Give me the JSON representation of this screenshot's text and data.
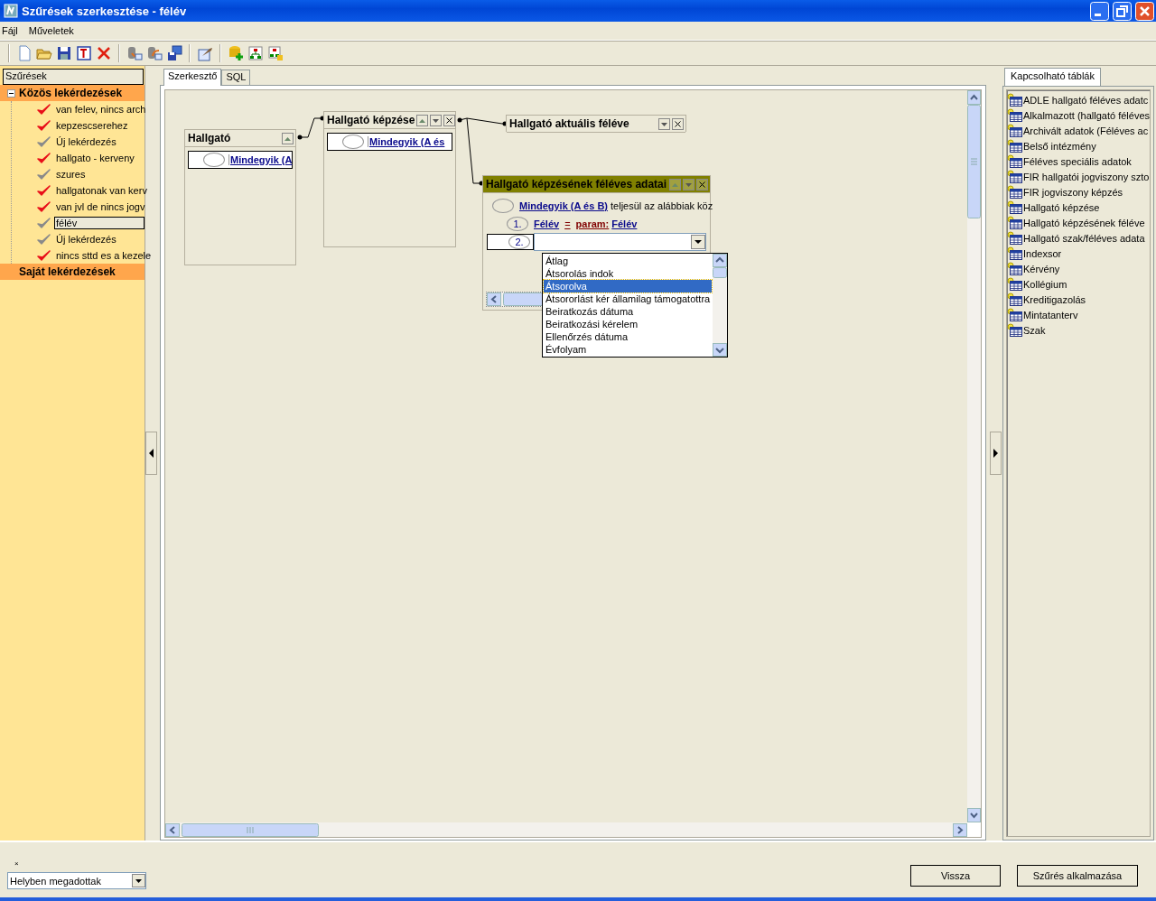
{
  "window": {
    "title": "Szűrések szerkesztése - félév"
  },
  "menu": [
    {
      "label": "Fájl"
    },
    {
      "label": "Műveletek"
    }
  ],
  "tree": {
    "header": "Szűrések",
    "groups": [
      {
        "label": "Közös lekérdezések",
        "expanded": true,
        "children": [
          {
            "label": "van felev, nincs arch",
            "active": true,
            "selected": false
          },
          {
            "label": "kepzescserehez",
            "active": true,
            "selected": false
          },
          {
            "label": "Új lekérdezés",
            "active": false,
            "selected": false
          },
          {
            "label": "hallgato - kerveny",
            "active": true,
            "selected": false
          },
          {
            "label": "szures",
            "active": false,
            "selected": false
          },
          {
            "label": "hallgatonak van kerv",
            "active": true,
            "selected": false
          },
          {
            "label": "van jvl de nincs jogv",
            "active": true,
            "selected": false
          },
          {
            "label": "félév",
            "active": false,
            "selected": true
          },
          {
            "label": "Új lekérdezés",
            "active": false,
            "selected": false
          },
          {
            "label": "nincs sttd es a kezele",
            "active": true,
            "selected": false
          }
        ]
      },
      {
        "label": "Saját lekérdezések",
        "expanded": false
      }
    ]
  },
  "tabs": [
    {
      "label": "Szerkesztő",
      "selected": true
    },
    {
      "label": "SQL",
      "selected": false
    }
  ],
  "nodes": [
    {
      "title": "Hallgató",
      "controls": [
        {
          "kind": "up"
        }
      ],
      "highlighted": false,
      "condition": {
        "link": "Mindegyik (A",
        "checked": false
      }
    },
    {
      "title": "Hallgató képzése",
      "controls": [
        {
          "kind": "up"
        },
        {
          "kind": "down"
        },
        {
          "kind": "close"
        }
      ],
      "highlighted": false,
      "condition": {
        "link": "Mindegyik (A és",
        "checked": false
      }
    },
    {
      "title": "Hallgató aktuális féléve",
      "controls": [
        {
          "kind": "down"
        },
        {
          "kind": "close"
        }
      ],
      "highlighted": false
    },
    {
      "title": "Hallgató képzésének féléves adatai",
      "controls": [
        {
          "kind": "up"
        },
        {
          "kind": "down"
        },
        {
          "kind": "close"
        }
      ],
      "highlighted": true,
      "condition": {
        "link": "Mindegyik (A és B)",
        "text": " teljesül az alábbiak köz",
        "checked": false
      },
      "rules": [
        {
          "kind": "condition",
          "number": "1.",
          "field": "Félév",
          "operator": "=",
          "param_label": "param:",
          "value": "Félév"
        },
        {
          "kind": "select",
          "number": "2.",
          "dropdown": {
            "options": [
              {
                "label": "Átlag",
                "selected": false
              },
              {
                "label": "Átsorolás indok",
                "selected": false
              },
              {
                "label": "Átsorolva",
                "selected": true
              },
              {
                "label": "Átsororlást kér államilag támogatottra",
                "selected": false
              },
              {
                "label": "Beiratkozás dátuma",
                "selected": false
              },
              {
                "label": "Beiratkozási kérelem",
                "selected": false
              },
              {
                "label": "Ellenőrzés dátuma",
                "selected": false
              },
              {
                "label": "Évfolyam",
                "selected": false
              }
            ]
          }
        }
      ]
    }
  ],
  "side_tabs": [
    {
      "label": "Kapcsolható táblák",
      "selected": true
    }
  ],
  "tables": [
    "ADLE hallgató féléves adatc",
    "Alkalmazott (hallgató féléves",
    "Archivált adatok (Féléves ac",
    "Belső intézmény",
    "Féléves speciális adatok",
    "FIR hallgatói jogviszony szto",
    "FIR jogviszony képzés",
    "Hallgató képzése",
    "Hallgató képzésének féléve",
    "Hallgató szak/féléves adata",
    "Indexsor",
    "Kérvény",
    "Kollégium",
    "Kreditigazolás",
    "Mintatanterv",
    "Szak"
  ],
  "bottom": {
    "marker": "×",
    "source": "Helyben megadottak",
    "buttons": [
      "Vissza",
      "Szűrés alkalmazása"
    ]
  }
}
